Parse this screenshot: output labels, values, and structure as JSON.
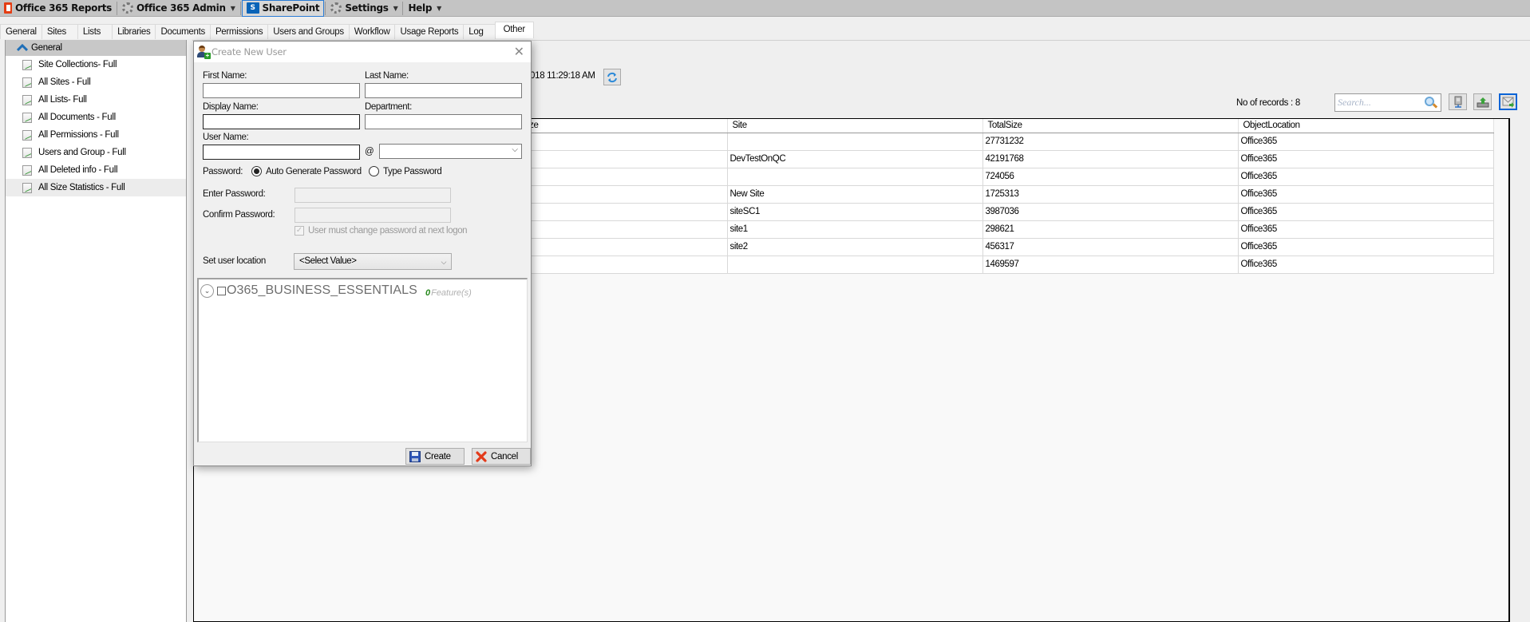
{
  "menubar": {
    "items": [
      {
        "label": "Office 365 Reports",
        "icon": "office-icon",
        "dropdown": false
      },
      {
        "label": "Office 365 Admin",
        "icon": "gear-icon",
        "dropdown": true
      },
      {
        "label": "SharePoint",
        "icon": "sharepoint-icon",
        "dropdown": false,
        "active": true
      },
      {
        "label": "Settings",
        "icon": "gear-icon",
        "dropdown": true
      },
      {
        "label": "Help",
        "icon": "",
        "dropdown": true
      }
    ]
  },
  "tabs": [
    "General",
    "Sites",
    "Lists",
    "Libraries",
    "Documents",
    "Permissions",
    "Users and Groups",
    "Workflow",
    "Usage Reports",
    "Log",
    "Other"
  ],
  "selected_tab": "Other",
  "sidebar": {
    "group": "General",
    "items": [
      "Site Collections- Full",
      "All Sites - Full",
      "All Lists- Full",
      "All Documents - Full",
      "All Permissions - Full",
      "Users and Group - Full",
      "All Deleted info - Full",
      "All Size Statistics - Full"
    ],
    "selected": "All Size Statistics - Full"
  },
  "report": {
    "timestamp_partial": "018 11:29:18 AM",
    "records_label": "No of records : 8",
    "search_placeholder": "Search...",
    "columns": [
      "ize",
      "Site",
      "TotalSize",
      "ObjectLocation"
    ],
    "rows": [
      {
        "size": "",
        "site": "",
        "total": "27731232",
        "location": "Office365"
      },
      {
        "size": "",
        "site": "DevTestOnQC",
        "total": "42191768",
        "location": "Office365"
      },
      {
        "size": "",
        "site": "",
        "total": "724056",
        "location": "Office365"
      },
      {
        "size": "",
        "site": "New Site",
        "total": "1725313",
        "location": "Office365"
      },
      {
        "size": "",
        "site": "siteSC1",
        "total": "3987036",
        "location": "Office365"
      },
      {
        "size": "",
        "site": "site1",
        "total": "298621",
        "location": "Office365"
      },
      {
        "size": "",
        "site": "site2",
        "total": "456317",
        "location": "Office365"
      },
      {
        "size": "",
        "site": "",
        "total": "1469597",
        "location": "Office365"
      }
    ]
  },
  "dialog": {
    "title": "Create New User",
    "first_name_label": "First Name:",
    "first_name_value": "",
    "last_name_label": "Last Name:",
    "last_name_value": "",
    "display_name_label": "Display Name:",
    "display_name_value": "",
    "department_label": "Department:",
    "department_value": "",
    "user_name_label": "User Name:",
    "user_name_value": "",
    "at_sign": "@",
    "domain_value": "",
    "password_label": "Password:",
    "auto_generate_label": "Auto Generate Password",
    "type_password_label": "Type Password",
    "password_mode": "auto",
    "enter_password_label": "Enter Password:",
    "confirm_password_label": "Confirm Password:",
    "must_change_label": "User must change password at next logon",
    "must_change_checked": true,
    "location_label": "Set user location",
    "location_value": "<Select Value>",
    "license_name": "O365_BUSINESS_ESSENTIALS",
    "license_feature_count": "0",
    "license_feature_label": "Feature(s)",
    "create_label": "Create",
    "cancel_label": "Cancel"
  }
}
